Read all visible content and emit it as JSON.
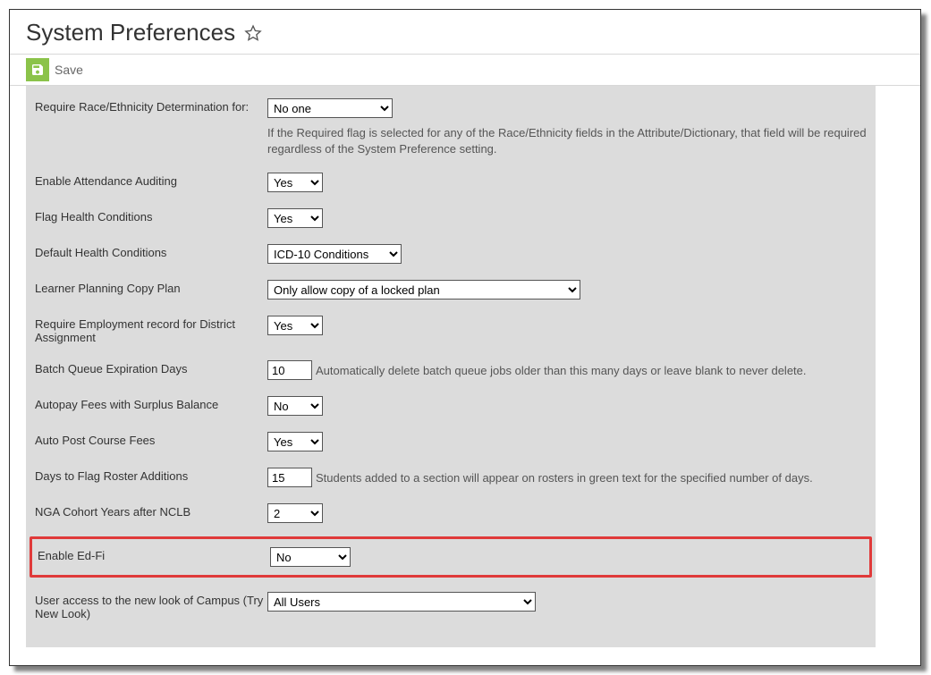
{
  "page": {
    "title": "System Preferences"
  },
  "toolbar": {
    "save_label": "Save"
  },
  "prefs": {
    "race_label": "Require Race/Ethnicity Determination for:",
    "race_value": "No one",
    "race_hint": "If the Required flag is selected for any of the Race/Ethnicity fields in the Attribute/Dictionary, that field will be required regardless of the System Preference setting.",
    "attendance_label": "Enable Attendance Auditing",
    "attendance_value": "Yes",
    "flag_health_label": "Flag Health Conditions",
    "flag_health_value": "Yes",
    "default_health_label": "Default Health Conditions",
    "default_health_value": "ICD-10 Conditions",
    "learner_plan_label": "Learner Planning Copy Plan",
    "learner_plan_value": "Only allow copy of a locked plan",
    "employ_label": "Require Employment record for District Assignment",
    "employ_value": "Yes",
    "batch_label": "Batch Queue Expiration Days",
    "batch_value": "10",
    "batch_hint": "Automatically delete batch queue jobs older than this many days or leave blank to never delete.",
    "autopay_label": "Autopay Fees with Surplus Balance",
    "autopay_value": "No",
    "autopost_label": "Auto Post Course Fees",
    "autopost_value": "Yes",
    "roster_label": "Days to Flag Roster Additions",
    "roster_value": "15",
    "roster_hint": "Students added to a section will appear on rosters in green text for the specified number of days.",
    "nga_label": "NGA Cohort Years after NCLB",
    "nga_value": "2",
    "edfi_label": "Enable Ed-Fi",
    "edfi_value": "No",
    "newlook_label": "User access to the new look of Campus (Try New Look)",
    "newlook_value": "All Users"
  }
}
